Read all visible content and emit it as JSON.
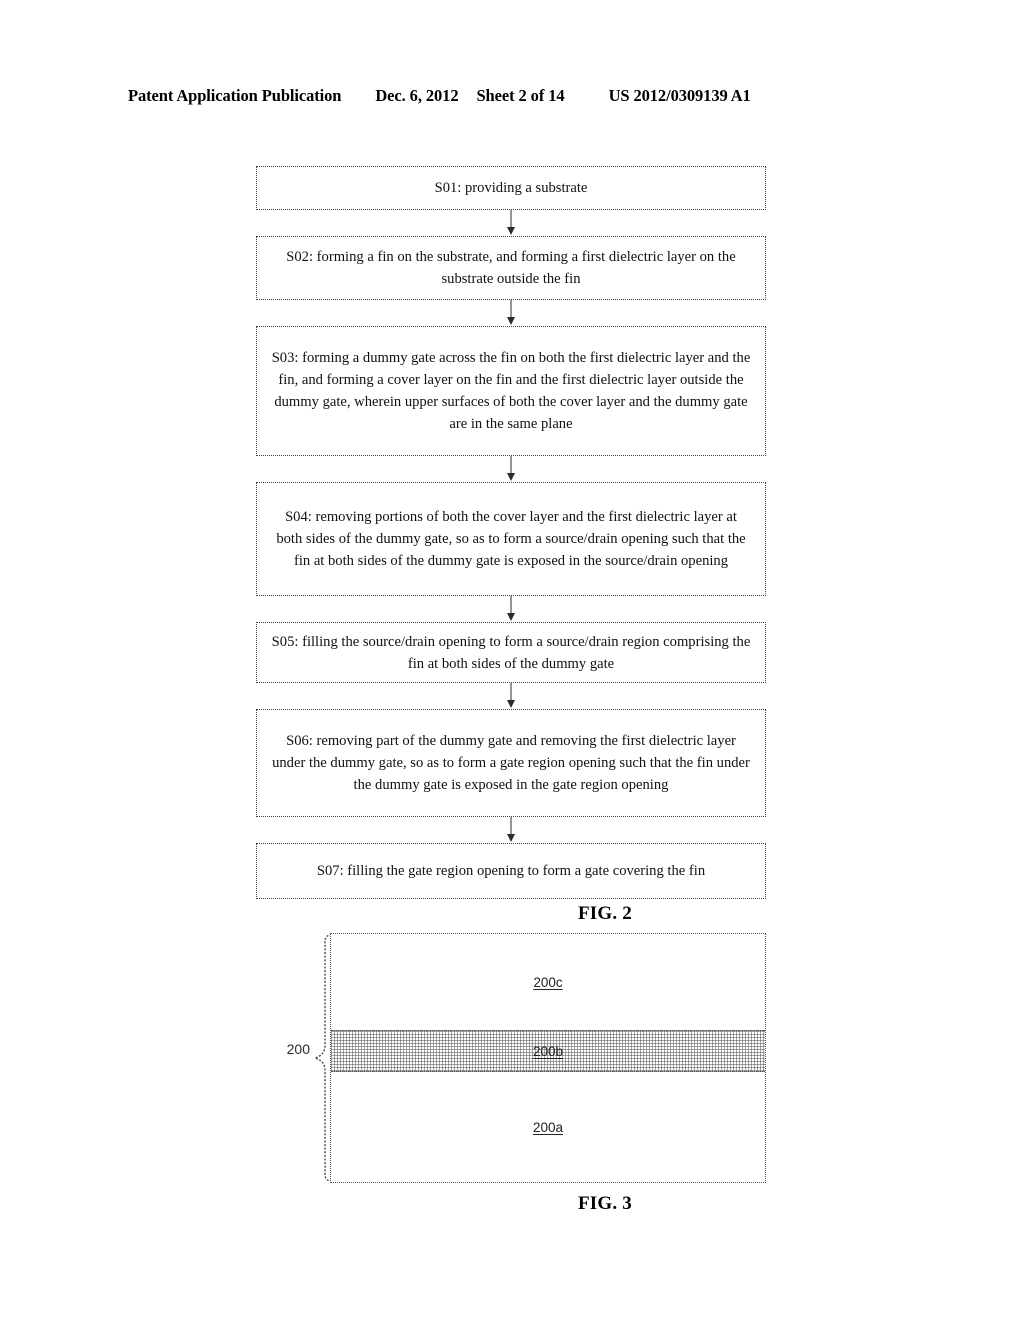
{
  "header": {
    "publication": "Patent Application Publication",
    "date": "Dec. 6, 2012",
    "sheet": "Sheet 2 of 14",
    "patent_number": "US 2012/0309139 A1"
  },
  "figures": [
    {
      "caption": "FIG. 2",
      "type": "flowchart",
      "steps": [
        {
          "id": "S01",
          "text": "S01: providing a substrate"
        },
        {
          "id": "S02",
          "text": "S02: forming a fin on the substrate, and forming a first dielectric layer on the substrate outside the fin"
        },
        {
          "id": "S03",
          "text": "S03: forming a dummy gate across the fin on both the first dielectric layer and the fin, and forming a cover layer on the fin and the first dielectric layer outside the dummy gate, wherein upper surfaces of both the cover layer and the dummy gate are in the same plane"
        },
        {
          "id": "S04",
          "text": "S04: removing portions of both the cover layer and the first dielectric layer at both sides of the dummy gate, so as to form a source/drain opening such that the fin at both sides of the dummy gate is exposed in the source/drain opening"
        },
        {
          "id": "S05",
          "text": "S05: filling the source/drain opening to form a source/drain region comprising the fin at both sides of the dummy gate"
        },
        {
          "id": "S06",
          "text": "S06: removing part of the dummy gate and removing the first dielectric layer under the dummy gate, so as to form a gate region opening such that the fin under the dummy gate is exposed in the gate region opening"
        },
        {
          "id": "S07",
          "text": "S07: filling the gate region opening to form a gate covering the fin"
        }
      ]
    },
    {
      "caption": "FIG. 3",
      "type": "cross-section",
      "bracket_label": "200",
      "layers": [
        {
          "label": "200c",
          "fill": "white"
        },
        {
          "label": "200b",
          "fill": "hatched-gray"
        },
        {
          "label": "200a",
          "fill": "white"
        }
      ]
    }
  ],
  "colors": {
    "ink": "#111111",
    "border": "#404040",
    "hatch": "#5a5a5a",
    "page": "#ffffff"
  }
}
